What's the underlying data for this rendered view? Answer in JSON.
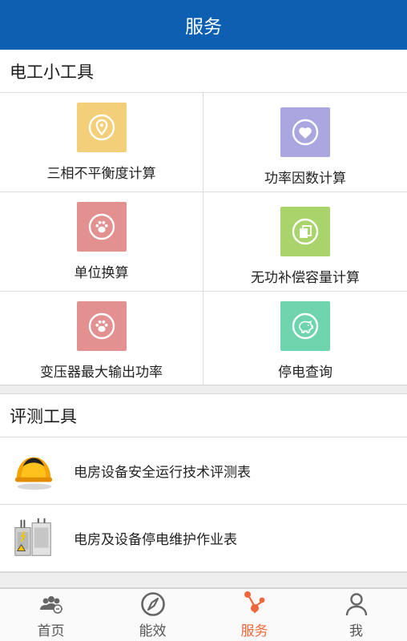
{
  "header": {
    "title": "服务"
  },
  "electrician_tools": {
    "title": "电工小工具",
    "items": [
      {
        "label": "三相不平衡度计算",
        "icon": "location-pin-icon",
        "color": "#f2cf78"
      },
      {
        "label": "功率因数计算",
        "icon": "heart-icon",
        "color": "#a9a6e0"
      },
      {
        "label": "单位换算",
        "icon": "paw-icon",
        "color": "#e29190"
      },
      {
        "label": "无功补偿容量计算",
        "icon": "copy-icon",
        "color": "#a8d46b"
      },
      {
        "label": "变压器最大输出功率",
        "icon": "paw-icon",
        "color": "#e29190"
      },
      {
        "label": "停电查询",
        "icon": "piggy-bank-icon",
        "color": "#6ed4ad"
      }
    ]
  },
  "evaluation_tools": {
    "title": "评测工具",
    "items": [
      {
        "label": "电房设备安全运行技术评测表",
        "icon": "hard-hat-icon"
      },
      {
        "label": "电房及设备停电维护作业表",
        "icon": "electrical-cabinet-icon"
      }
    ]
  },
  "tabbar": {
    "items": [
      {
        "label": "首页",
        "icon": "group-icon"
      },
      {
        "label": "能效",
        "icon": "compass-icon"
      },
      {
        "label": "服务",
        "icon": "share-node-icon",
        "active": true
      },
      {
        "label": "我",
        "icon": "user-icon"
      }
    ],
    "active_color": "#f0663a",
    "inactive_color": "#555555"
  },
  "colors": {
    "header": "#0d5fb1"
  }
}
